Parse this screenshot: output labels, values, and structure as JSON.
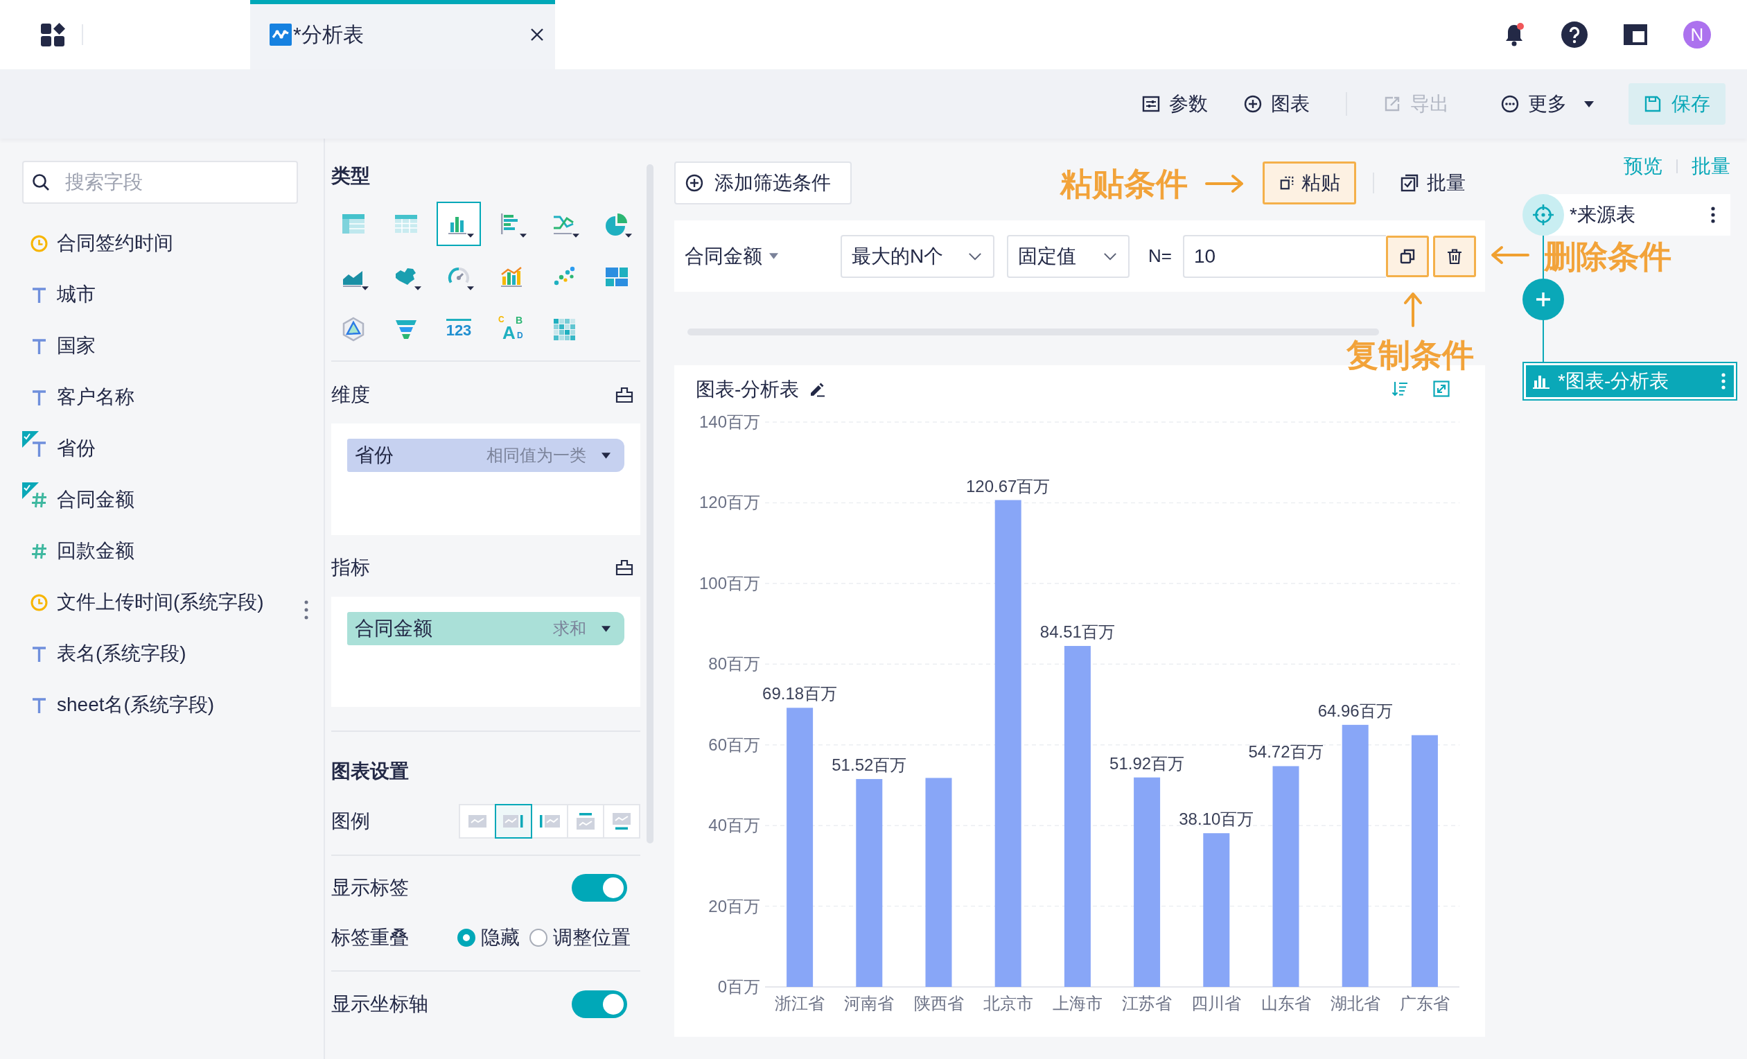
{
  "top_bar": {
    "tabs": [
      {
        "title": "*分析表",
        "selected": true
      }
    ],
    "bell": {
      "unread": true
    },
    "avatar": {
      "initial": "N"
    }
  },
  "toolbar": {
    "buttons": [
      {
        "kind": "params",
        "label": "参数",
        "disabled": false
      },
      {
        "kind": "add",
        "label": "图表",
        "disabled": false
      },
      {
        "kind": "export",
        "label": "导出",
        "disabled": true,
        "separator_before": true
      },
      {
        "kind": "more",
        "label": "更多",
        "disabled": false
      },
      {
        "kind": "save",
        "label": "保存",
        "disabled": false
      }
    ]
  },
  "fields_panel": {
    "search": {
      "placeholder": "搜索字段"
    },
    "fields": [
      {
        "kind": "date",
        "name": "合同签约时间",
        "used": false
      },
      {
        "kind": "text",
        "name": "城市",
        "used": false
      },
      {
        "kind": "text",
        "name": "国家",
        "used": false
      },
      {
        "kind": "text",
        "name": "客户名称",
        "used": false
      },
      {
        "kind": "text",
        "name": "省份",
        "used": true
      },
      {
        "kind": "number",
        "name": "合同金额",
        "used": true
      },
      {
        "kind": "number",
        "name": "回款金额",
        "used": false
      },
      {
        "kind": "date",
        "name": "文件上传时间(系统字段)",
        "used": false
      },
      {
        "kind": "text",
        "name": "表名(系统字段)",
        "used": false
      },
      {
        "kind": "text",
        "name": "sheet名(系统字段)",
        "used": false
      }
    ]
  },
  "config_panel": {
    "type_title": "类型",
    "chart_types": [
      {
        "kind": "table",
        "has_menu": false,
        "selected": false
      },
      {
        "kind": "cross_table",
        "has_menu": false,
        "selected": false
      },
      {
        "kind": "bar",
        "has_menu": true,
        "selected": true
      },
      {
        "kind": "horizontal_bar",
        "has_menu": true,
        "selected": false
      },
      {
        "kind": "line",
        "has_menu": true,
        "selected": false
      },
      {
        "kind": "pie",
        "has_menu": true,
        "selected": false
      },
      {
        "kind": "area",
        "has_menu": true,
        "selected": false
      },
      {
        "kind": "map",
        "has_menu": true,
        "selected": false
      },
      {
        "kind": "gauge",
        "has_menu": true,
        "selected": false
      },
      {
        "kind": "combo",
        "has_menu": false,
        "selected": false
      },
      {
        "kind": "scatter",
        "has_menu": false,
        "selected": false
      },
      {
        "kind": "treemap",
        "has_menu": false,
        "selected": false
      },
      {
        "kind": "radar",
        "has_menu": false,
        "selected": false
      },
      {
        "kind": "funnel",
        "has_menu": false,
        "selected": false
      },
      {
        "kind": "number",
        "glyph": "123",
        "has_menu": false,
        "selected": false
      },
      {
        "kind": "word_cloud",
        "glyph": "CABD",
        "has_menu": false,
        "selected": false
      },
      {
        "kind": "heatmap",
        "has_menu": false,
        "selected": false
      }
    ],
    "sections": [
      {
        "kind": "dimension",
        "title": "维度",
        "items": [
          {
            "name": "省份",
            "mode": "相同值为一类"
          }
        ]
      },
      {
        "kind": "measure",
        "title": "指标",
        "items": [
          {
            "name": "合同金额",
            "mode": "求和"
          }
        ]
      }
    ],
    "settings": {
      "title": "图表设置",
      "legend": {
        "label": "图例",
        "positions": [
          {
            "kind": "none",
            "selected": false
          },
          {
            "kind": "right",
            "selected": true
          },
          {
            "kind": "left",
            "selected": false
          },
          {
            "kind": "top",
            "selected": false
          },
          {
            "kind": "bottom",
            "selected": false
          }
        ]
      },
      "show_labels": {
        "label": "显示标签",
        "on": true
      },
      "label_overlap": {
        "label": "标签重叠",
        "options": [
          {
            "label": "隐藏",
            "selected": true
          },
          {
            "label": "调整位置",
            "selected": false
          }
        ]
      },
      "show_axis": {
        "label": "显示坐标轴",
        "on": true
      }
    }
  },
  "filter": {
    "add_button": "添加筛选条件",
    "paste_button": "粘贴",
    "batch_button": "批量",
    "condition": {
      "field": "合同金额",
      "rule": "最大的N个",
      "value_type": "固定值",
      "n_label": "N=",
      "n_value": "10"
    }
  },
  "annotations": [
    {
      "kind": "paste",
      "text": "粘贴条件"
    },
    {
      "kind": "delete",
      "text": "删除条件"
    },
    {
      "kind": "copy",
      "text": "复制条件"
    }
  ],
  "chart_card": {
    "title": "图表-分析表",
    "chart_data": {
      "type": "bar",
      "categories": [
        "浙江省",
        "河南省",
        "陕西省",
        "北京市",
        "上海市",
        "江苏省",
        "四川省",
        "山东省",
        "湖北省",
        "广东省"
      ],
      "values": [
        69.18,
        51.52,
        51.8,
        120.67,
        84.51,
        51.92,
        38.1,
        54.72,
        64.96,
        62.4
      ],
      "ylim": [
        0,
        140
      ],
      "yticks": [
        {
          "value": 0,
          "label": "0百万"
        },
        {
          "value": 20,
          "label": "20百万"
        },
        {
          "value": 40,
          "label": "40百万"
        },
        {
          "value": 60,
          "label": "60百万"
        },
        {
          "value": 80,
          "label": "80百万"
        },
        {
          "value": 100,
          "label": "100百万"
        },
        {
          "value": 120,
          "label": "120百万"
        },
        {
          "value": 140,
          "label": "140百万"
        }
      ],
      "grid": true,
      "value_labels": [
        "69.18百万",
        "51.52百万",
        null,
        "120.67百万",
        "84.51百万",
        "51.92百万",
        "38.10百万",
        "54.72百万",
        "64.96百万",
        null
      ]
    }
  },
  "flow_panel": {
    "links": [
      "预览",
      "批量"
    ],
    "nodes": [
      {
        "kind": "source",
        "label": "*来源表",
        "selected": false
      },
      {
        "kind": "chart",
        "label": "*图表-分析表",
        "selected": true
      }
    ]
  }
}
